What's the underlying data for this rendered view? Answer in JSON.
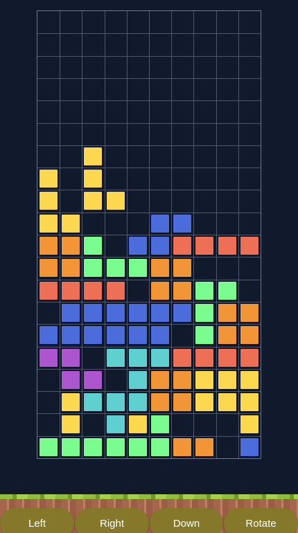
{
  "board": {
    "columns": 10,
    "rows": 20,
    "colors": {
      "Y": "#fbd84f",
      "O": "#f29536",
      "R": "#ec6f56",
      "G": "#7afd8e",
      "B": "#4c6cdc",
      "C": "#5fcfcf",
      "P": "#ac55cf"
    },
    "grid": [
      "..........",
      "..........",
      "..........",
      "..........",
      "..........",
      "..........",
      "..Y.......",
      "Y.Y.......",
      "Y.YY......",
      "YY...BB...",
      "OOG.BBRRRR",
      "OOGGGOO...",
      "RRRR.OOGG.",
      ".BBBBBBGOO",
      "BBBBBB.GOO",
      "PP.CCCRRRR",
      ".PP.COOYYY",
      ".YCCCOOYYY",
      ".Y.CYG...Y",
      "GGGGGGOO.B"
    ]
  },
  "controls": {
    "left": "Left",
    "right": "Right",
    "down": "Down",
    "rotate": "Rotate"
  }
}
